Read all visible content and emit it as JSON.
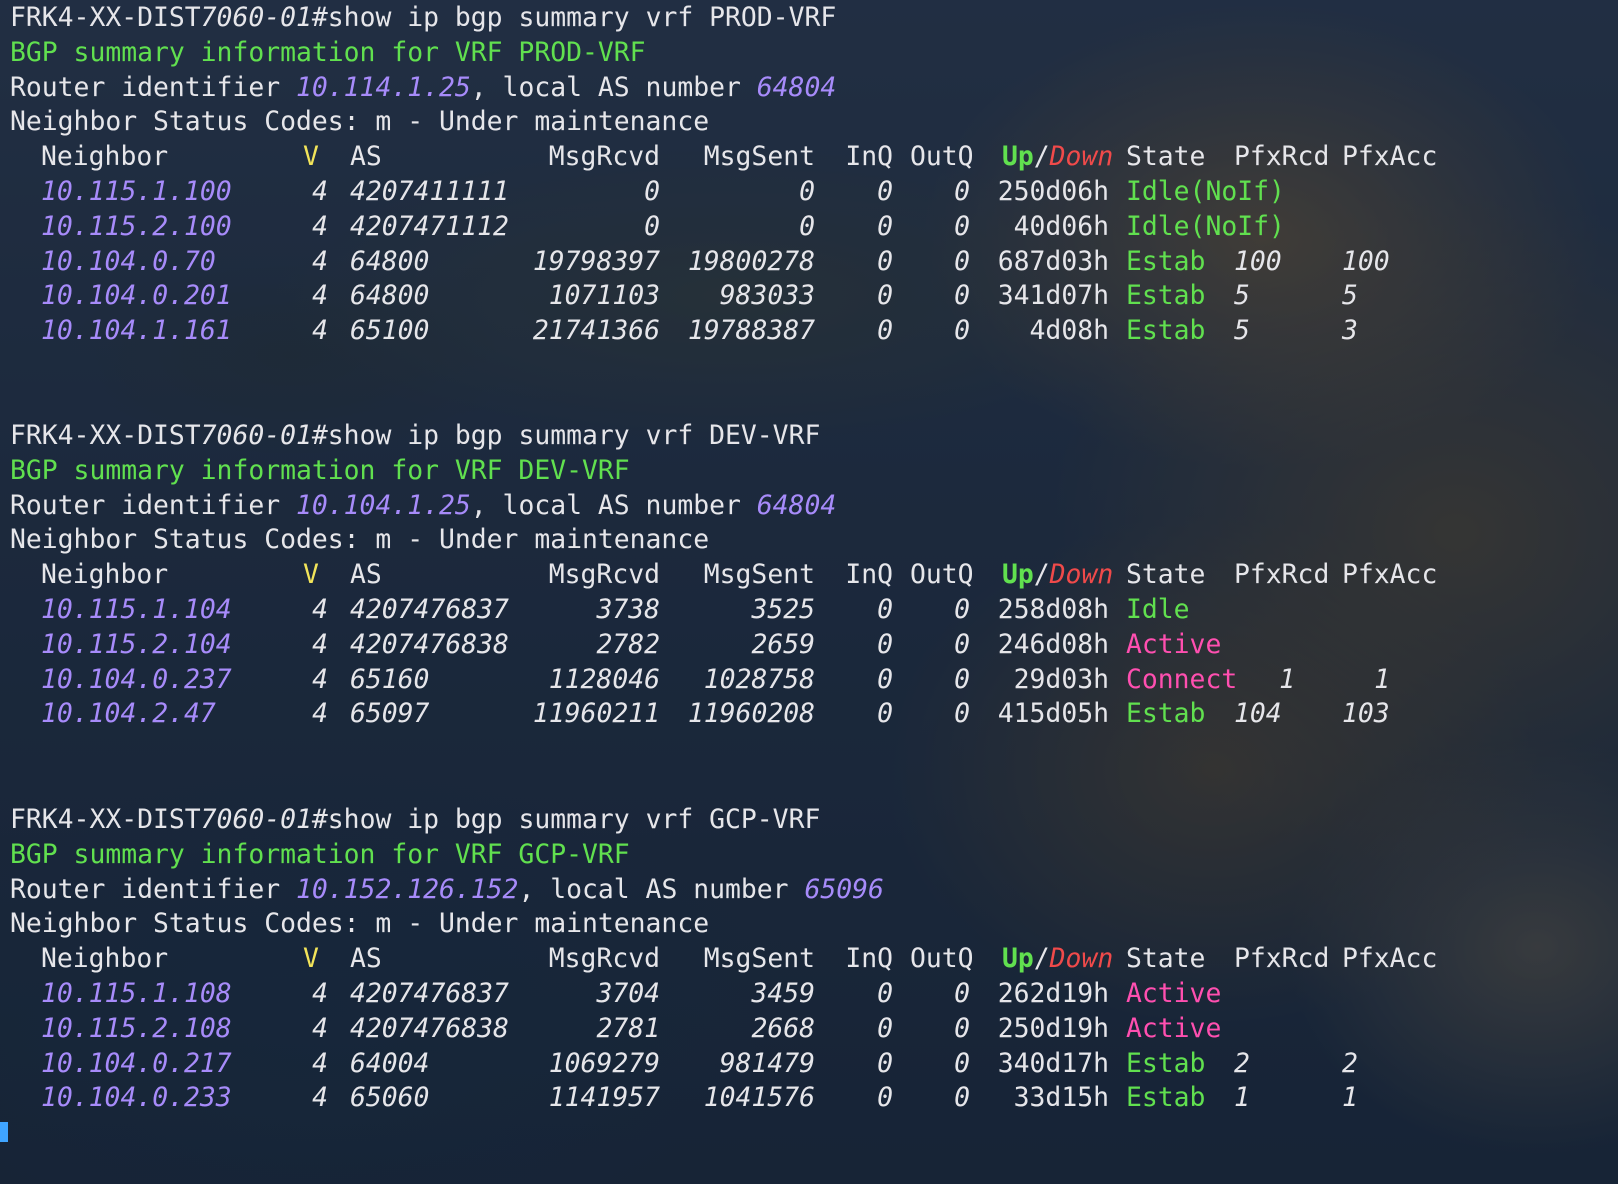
{
  "terminal": {
    "prompt_host": "FRK4-XX-DIST",
    "prompt_model": "7060-01",
    "prompt_suffix": "#show ip bgp summary vrf ",
    "router_id_prefix": "Router identifier ",
    "local_as_label": ", local AS number ",
    "status_codes": "Neighbor Status Codes: m - Under maintenance",
    "headers": {
      "neighbor": "Neighbor",
      "v": "V",
      "as": "AS",
      "msgrcvd": "MsgRcvd",
      "msgsent": "MsgSent",
      "inq": "InQ",
      "outq": "OutQ",
      "up": "Up",
      "slash": "/",
      "down": "Down",
      "state": "State",
      "pfxrcd": "PfxRcd",
      "pfxacc": "PfxAcc"
    },
    "sections": [
      {
        "vrf": "PROD-VRF",
        "summary_line": "BGP summary information for VRF PROD-VRF",
        "router_id": "10.114.1.25",
        "local_as": "64804",
        "rows": [
          {
            "neighbor": "10.115.1.100",
            "v": "4",
            "as": "4207411111",
            "msgrcvd": "0",
            "msgsent": "0",
            "inq": "0",
            "outq": "0",
            "updown": "250d06h",
            "state": "Idle(NoIf)",
            "state_color": "green",
            "pfxrcd": "",
            "pfxacc": ""
          },
          {
            "neighbor": "10.115.2.100",
            "v": "4",
            "as": "4207471112",
            "msgrcvd": "0",
            "msgsent": "0",
            "inq": "0",
            "outq": "0",
            "updown": "40d06h",
            "state": "Idle(NoIf)",
            "state_color": "green",
            "pfxrcd": "",
            "pfxacc": ""
          },
          {
            "neighbor": "10.104.0.70",
            "v": "4",
            "as": "64800",
            "msgrcvd": "19798397",
            "msgsent": "19800278",
            "inq": "0",
            "outq": "0",
            "updown": "687d03h",
            "state": "Estab",
            "state_color": "green",
            "pfxrcd": "100",
            "pfxacc": "100"
          },
          {
            "neighbor": "10.104.0.201",
            "v": "4",
            "as": "64800",
            "msgrcvd": "1071103",
            "msgsent": "983033",
            "inq": "0",
            "outq": "0",
            "updown": "341d07h",
            "state": "Estab",
            "state_color": "green",
            "pfxrcd": "5",
            "pfxacc": "5"
          },
          {
            "neighbor": "10.104.1.161",
            "v": "4",
            "as": "65100",
            "msgrcvd": "21741366",
            "msgsent": "19788387",
            "inq": "0",
            "outq": "0",
            "updown": "4d08h",
            "state": "Estab",
            "state_color": "green",
            "pfxrcd": "5",
            "pfxacc": "3"
          }
        ]
      },
      {
        "vrf": "DEV-VRF",
        "summary_line": "BGP summary information for VRF DEV-VRF",
        "router_id": "10.104.1.25",
        "local_as": "64804",
        "rows": [
          {
            "neighbor": "10.115.1.104",
            "v": "4",
            "as": "4207476837",
            "msgrcvd": "3738",
            "msgsent": "3525",
            "inq": "0",
            "outq": "0",
            "updown": "258d08h",
            "state": "Idle",
            "state_color": "green",
            "pfxrcd": "",
            "pfxacc": ""
          },
          {
            "neighbor": "10.115.2.104",
            "v": "4",
            "as": "4207476838",
            "msgrcvd": "2782",
            "msgsent": "2659",
            "inq": "0",
            "outq": "0",
            "updown": "246d08h",
            "state": "Active",
            "state_color": "pink",
            "pfxrcd": "",
            "pfxacc": ""
          },
          {
            "neighbor": "10.104.0.237",
            "v": "4",
            "as": "65160",
            "msgrcvd": "1128046",
            "msgsent": "1028758",
            "inq": "0",
            "outq": "0",
            "updown": "29d03h",
            "state": "Connect",
            "state_color": "pink",
            "pfxrcd": "1",
            "pfxacc": "1"
          },
          {
            "neighbor": "10.104.2.47",
            "v": "4",
            "as": "65097",
            "msgrcvd": "11960211",
            "msgsent": "11960208",
            "inq": "0",
            "outq": "0",
            "updown": "415d05h",
            "state": "Estab",
            "state_color": "green",
            "pfxrcd": "104",
            "pfxacc": "103"
          }
        ]
      },
      {
        "vrf": "GCP-VRF",
        "summary_line": "BGP summary information for VRF GCP-VRF",
        "router_id": "10.152.126.152",
        "local_as": "65096",
        "rows": [
          {
            "neighbor": "10.115.1.108",
            "v": "4",
            "as": "4207476837",
            "msgrcvd": "3704",
            "msgsent": "3459",
            "inq": "0",
            "outq": "0",
            "updown": "262d19h",
            "state": "Active",
            "state_color": "pink",
            "pfxrcd": "",
            "pfxacc": ""
          },
          {
            "neighbor": "10.115.2.108",
            "v": "4",
            "as": "4207476838",
            "msgrcvd": "2781",
            "msgsent": "2668",
            "inq": "0",
            "outq": "0",
            "updown": "250d19h",
            "state": "Active",
            "state_color": "pink",
            "pfxrcd": "",
            "pfxacc": ""
          },
          {
            "neighbor": "10.104.0.217",
            "v": "4",
            "as": "64004",
            "msgrcvd": "1069279",
            "msgsent": "981479",
            "inq": "0",
            "outq": "0",
            "updown": "340d17h",
            "state": "Estab",
            "state_color": "green",
            "pfxrcd": "2",
            "pfxacc": "2"
          },
          {
            "neighbor": "10.104.0.233",
            "v": "4",
            "as": "65060",
            "msgrcvd": "1141957",
            "msgsent": "1041576",
            "inq": "0",
            "outq": "0",
            "updown": "33d15h",
            "state": "Estab",
            "state_color": "green",
            "pfxrcd": "1",
            "pfxacc": "1"
          }
        ]
      }
    ]
  },
  "colors": {
    "green": "#61e04f",
    "purple": "#a78bfa",
    "yellow": "#f2e45a",
    "red": "#f04a4a",
    "pink": "#ff4fb0",
    "cursor": "#3fa4ff"
  }
}
